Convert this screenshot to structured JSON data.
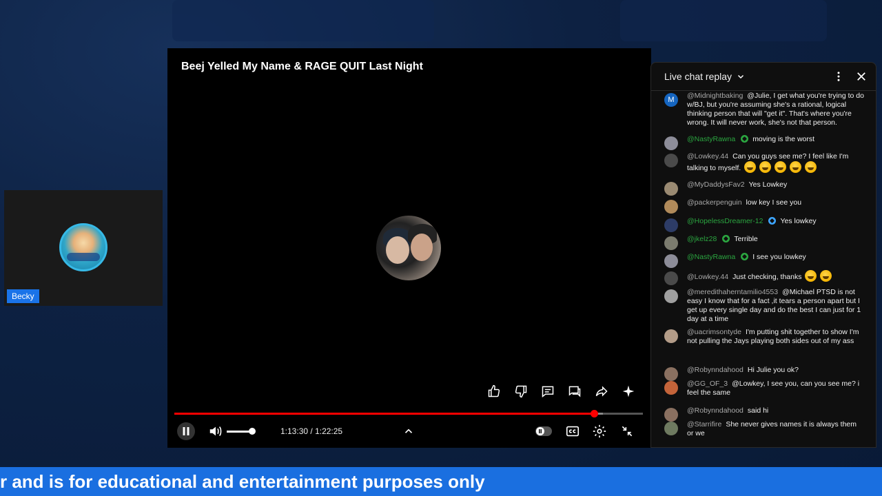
{
  "webcam": {
    "name": "Becky"
  },
  "player": {
    "title": "Beej Yelled My Name & RAGE QUIT Last Night",
    "time_current": "1:13:30",
    "time_separator": " / ",
    "time_total": "1:22:25",
    "progress_played": 0.895,
    "progress_buffered": 0.915,
    "volume_level": 0.85,
    "actions": [
      "like-icon",
      "dislike-icon",
      "comment-icon",
      "chat-icon",
      "share-icon",
      "sparkle-icon"
    ]
  },
  "chat": {
    "header_title": "Live chat replay",
    "messages": [
      {
        "author": "@Midnightbaking",
        "member": false,
        "text": "@Julie, I get what you're trying to do w/BJ, but you're assuming she's a rational, logical thinking person that will \"get it\". That's where you're wrong. It will never work, she's not that person.",
        "avatar_letter": "M",
        "avatar_color": "#1565c0"
      },
      {
        "author": "@NastyRawna",
        "member": true,
        "text": "moving is the worst",
        "avatar_color": "#8d8d99"
      },
      {
        "author": "@Lowkey.44",
        "member": false,
        "text": "Can you guys see me? I feel like I'm talking to myself.",
        "emoji_count": 5,
        "avatar_color": "#4a4a4a"
      },
      {
        "author": "@MyDaddysFav2",
        "member": false,
        "text": "Yes Lowkey",
        "avatar_color": "#9a8a72"
      },
      {
        "author": "@packerpenguin",
        "member": false,
        "text": "low key I see you",
        "avatar_color": "#b08a5a"
      },
      {
        "author": "@HopelessDreamer-12",
        "member": true,
        "badge": "blue",
        "text": "Yes lowkey",
        "avatar_color": "#2d3c66"
      },
      {
        "author": "@jkelz28",
        "member": true,
        "text": "Terrible",
        "avatar_color": "#7b7b6e"
      },
      {
        "author": "@NastyRawna",
        "member": true,
        "text": "I see you lowkey",
        "avatar_color": "#8d8d99"
      },
      {
        "author": "@Lowkey.44",
        "member": false,
        "text": "Just checking, thanks",
        "emoji_count": 2,
        "avatar_color": "#4a4a4a"
      },
      {
        "author": "@meredithaherntamilio4553",
        "member": false,
        "text": "@Michael PTSD is not easy I know that for a fact ,it tears a person apart but I get up every single day and do the best I can just for 1 day at a time",
        "avatar_color": "#a0a0a0"
      },
      {
        "author": "@uacrimsontyde",
        "member": false,
        "text": "I'm putting shit together to show I'm not pulling the Jays playing both sides out of my ass",
        "avatar_color": "#b39c88"
      },
      {
        "author": "@Robynndahood",
        "member": false,
        "text": "Hi Julie you ok?",
        "avatar_color": "#8a7060"
      },
      {
        "author": "@GG_OF_3",
        "member": false,
        "text": "@Lowkey, I see you, can you see me? i feel the same",
        "avatar_color": "#c4643a"
      },
      {
        "author": "@Robynndahood",
        "member": false,
        "text": "said hi",
        "avatar_color": "#8a7060"
      },
      {
        "author": "@Starrifire",
        "member": false,
        "text": "She never gives names it is always them or we",
        "avatar_color": "#6e7a60"
      }
    ]
  },
  "banner": {
    "text": "r and is for educational and entertainment purposes only"
  }
}
